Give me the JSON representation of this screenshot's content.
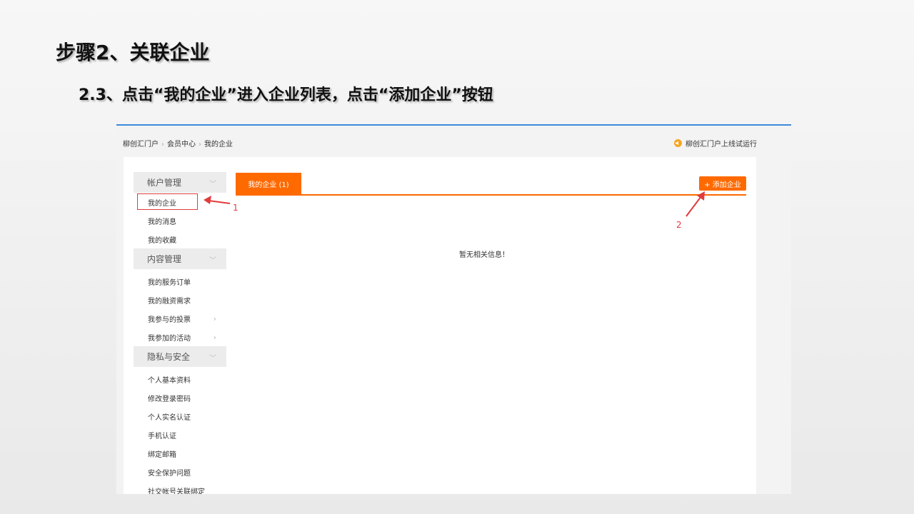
{
  "slide": {
    "heading": "步骤2、关联企业",
    "subheading": "2.3、点击“我的企业”进入企业列表，点击“添加企业”按钮"
  },
  "breadcrumb": [
    "柳创汇门户",
    "会员中心",
    "我的企业"
  ],
  "notice": "柳创汇门户上线试运行",
  "sidebar": {
    "groups": [
      {
        "label": "帐户管理",
        "items": [
          {
            "label": "我的企业",
            "highlighted": true
          },
          {
            "label": "我的消息"
          },
          {
            "label": "我的收藏"
          }
        ]
      },
      {
        "label": "内容管理",
        "items": [
          {
            "label": "我的服务订单"
          },
          {
            "label": "我的融资需求"
          },
          {
            "label": "我参与的投票",
            "arrow": true
          },
          {
            "label": "我参加的活动",
            "arrow": true
          }
        ]
      },
      {
        "label": "隐私与安全",
        "items": [
          {
            "label": "个人基本资料"
          },
          {
            "label": "修改登录密码"
          },
          {
            "label": "个人实名认证"
          },
          {
            "label": "手机认证"
          },
          {
            "label": "绑定邮箱"
          },
          {
            "label": "安全保护问题"
          },
          {
            "label": "社交帐号关联绑定"
          }
        ]
      }
    ]
  },
  "main": {
    "tab_label": "我的企业 (1)",
    "add_button": "+ 添加企业",
    "empty_text": "暂无相关信息！"
  },
  "annotations": {
    "one": "1",
    "two": "2"
  },
  "colors": {
    "accent": "#ff6a00",
    "annotation": "#e03c3c",
    "top_border": "#3b8ad9"
  }
}
